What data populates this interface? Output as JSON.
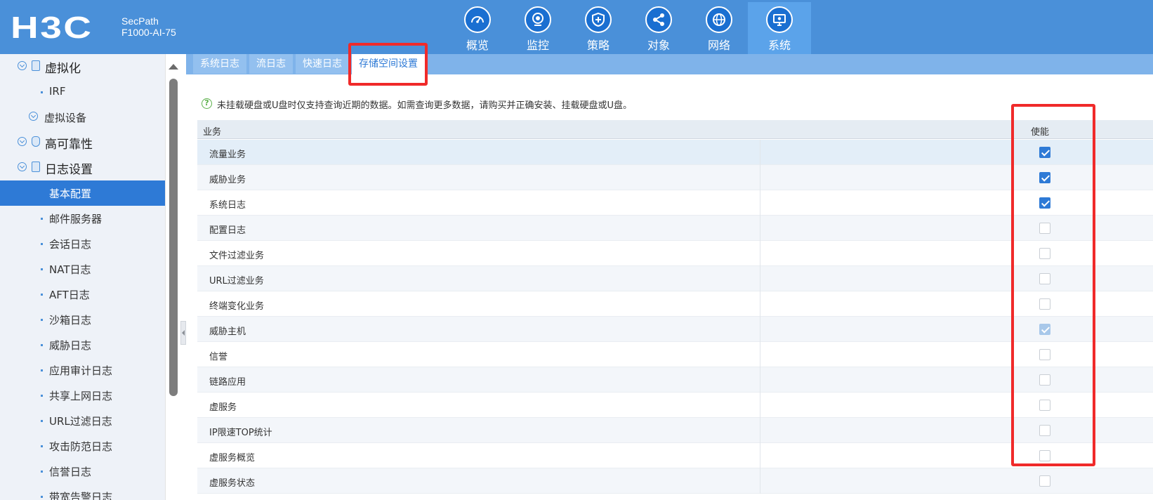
{
  "header": {
    "logo": "H3C",
    "product_line1": "SecPath",
    "product_line2": "F1000-AI-75",
    "nav": [
      {
        "label": "概览",
        "icon": "dashboard-icon"
      },
      {
        "label": "监控",
        "icon": "camera-icon"
      },
      {
        "label": "策略",
        "icon": "shield-plus-icon"
      },
      {
        "label": "对象",
        "icon": "share-nodes-icon"
      },
      {
        "label": "网络",
        "icon": "globe-icon"
      },
      {
        "label": "系统",
        "icon": "monitor-gear-icon",
        "active": true
      }
    ]
  },
  "sidebar": {
    "items": [
      {
        "label": "虚拟化",
        "level": "group"
      },
      {
        "label": "IRF",
        "level": "sub"
      },
      {
        "label": "虚拟设备",
        "level": "mid"
      },
      {
        "label": "高可靠性",
        "level": "group"
      },
      {
        "label": "日志设置",
        "level": "group"
      },
      {
        "label": "基本配置",
        "level": "sub",
        "active": true
      },
      {
        "label": "邮件服务器",
        "level": "sub"
      },
      {
        "label": "会话日志",
        "level": "sub"
      },
      {
        "label": "NAT日志",
        "level": "sub"
      },
      {
        "label": "AFT日志",
        "level": "sub"
      },
      {
        "label": "沙箱日志",
        "level": "sub"
      },
      {
        "label": "威胁日志",
        "level": "sub"
      },
      {
        "label": "应用审计日志",
        "level": "sub"
      },
      {
        "label": "共享上网日志",
        "level": "sub"
      },
      {
        "label": "URL过滤日志",
        "level": "sub"
      },
      {
        "label": "攻击防范日志",
        "level": "sub"
      },
      {
        "label": "信誉日志",
        "level": "sub"
      },
      {
        "label": "带宽告警日志",
        "level": "sub"
      }
    ]
  },
  "tabs": [
    {
      "label": "系统日志"
    },
    {
      "label": "流日志"
    },
    {
      "label": "快速日志"
    },
    {
      "label": "存储空间设置",
      "active": true
    }
  ],
  "notice": "未挂载硬盘或U盘时仅支持查询近期的数据。如需查询更多数据，请购买并正确安装、挂载硬盘或U盘。",
  "table": {
    "col_service": "业务",
    "col_enable": "使能",
    "rows": [
      {
        "name": "流量业务",
        "state": "checked"
      },
      {
        "name": "威胁业务",
        "state": "checked"
      },
      {
        "name": "系统日志",
        "state": "checked"
      },
      {
        "name": "配置日志",
        "state": "unchecked"
      },
      {
        "name": "文件过滤业务",
        "state": "unchecked"
      },
      {
        "name": "URL过滤业务",
        "state": "unchecked"
      },
      {
        "name": "终端变化业务",
        "state": "unchecked"
      },
      {
        "name": "威胁主机",
        "state": "checked-disabled"
      },
      {
        "name": "信誉",
        "state": "unchecked"
      },
      {
        "name": "链路应用",
        "state": "unchecked"
      },
      {
        "name": "虚服务",
        "state": "unchecked"
      },
      {
        "name": "IP限速TOP统计",
        "state": "unchecked"
      },
      {
        "name": "虚服务概览",
        "state": "unchecked"
      },
      {
        "name": "虚服务状态",
        "state": "unchecked"
      }
    ]
  },
  "colors": {
    "header_bg": "#4a90d9",
    "active_blue": "#2e7ad6",
    "highlight_red": "#f02a2a"
  }
}
